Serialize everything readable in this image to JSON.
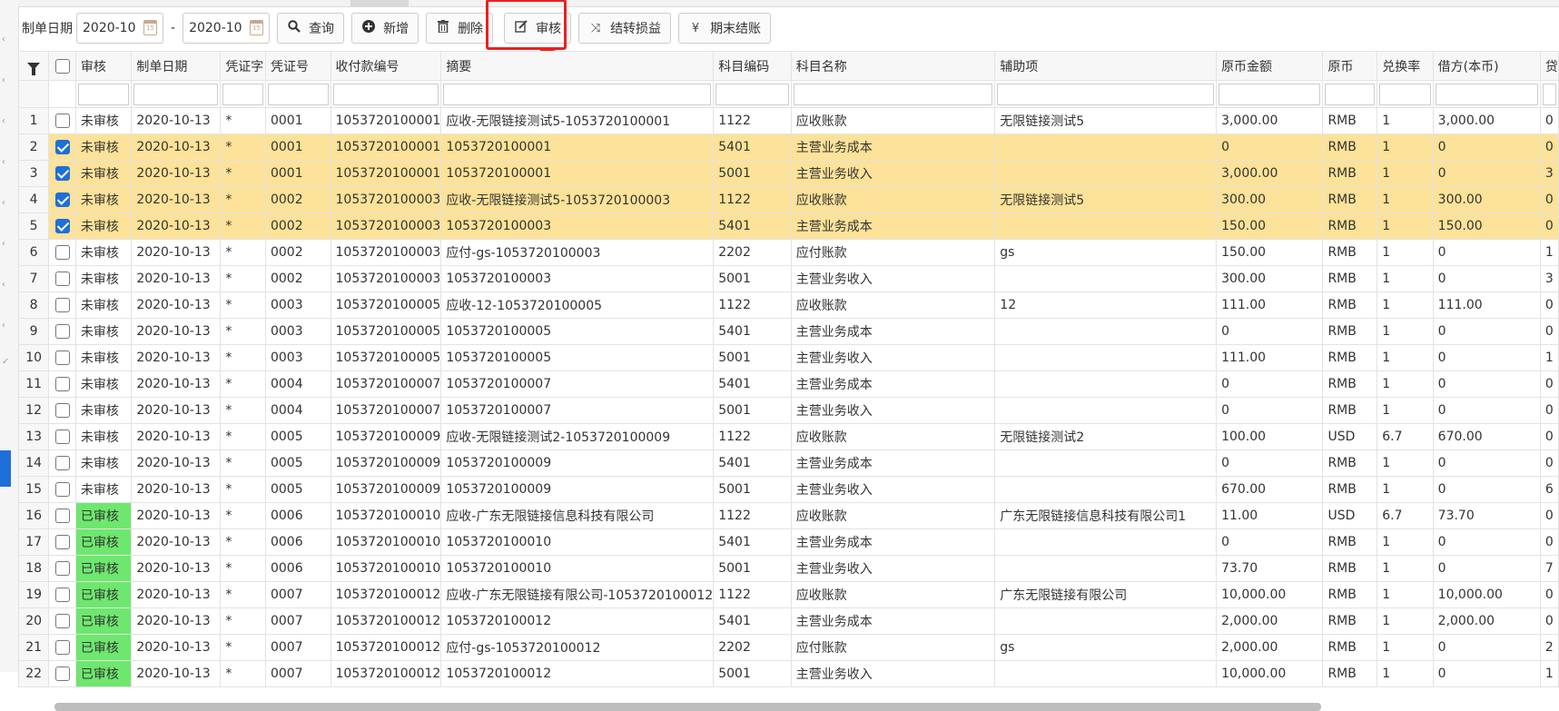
{
  "toolbar": {
    "date_label": "制单日期",
    "date_from": "2020-10",
    "date_to": "2020-10",
    "range_sep": "-",
    "buttons": {
      "query": "查询",
      "add": "新增",
      "delete": "删除",
      "audit": "审核",
      "carry_over": "结转损益",
      "period_end": "期末结账"
    },
    "icons": {
      "query": "search-icon",
      "add": "plus-circle-icon",
      "delete": "trash-icon",
      "audit": "edit-icon",
      "carry_over": "shuffle-icon",
      "period_end": "yen-icon"
    }
  },
  "colors": {
    "selected_row": "#fde299",
    "audited": "#6ee76e",
    "highlight": "#e8221f",
    "checkbox": "#1e6fd9"
  },
  "table": {
    "headers": [
      "审核",
      "制单日期",
      "凭证字",
      "凭证号",
      "收付款编号",
      "摘要",
      "科目编码",
      "科目名称",
      "辅助项",
      "原币金额",
      "原币",
      "兑换率",
      "借方(本币)",
      "贷"
    ],
    "rows": [
      {
        "num": "1",
        "checked": false,
        "status": "未审核",
        "audited": false,
        "date": "2020-10-13",
        "word": "*",
        "vno": "0001",
        "payno": "1053720100001",
        "summary": "应收-无限链接测试5-1053720100001",
        "code": "1122",
        "account": "应收账款",
        "aux": "无限链接测试5",
        "amount": "3,000.00",
        "cur": "RMB",
        "rate": "1",
        "debit": "3,000.00",
        "credit": "0"
      },
      {
        "num": "2",
        "checked": true,
        "status": "未审核",
        "audited": false,
        "date": "2020-10-13",
        "word": "*",
        "vno": "0001",
        "payno": "1053720100001",
        "summary": "1053720100001",
        "code": "5401",
        "account": "主营业务成本",
        "aux": "",
        "amount": "0",
        "cur": "RMB",
        "rate": "1",
        "debit": "0",
        "credit": "0"
      },
      {
        "num": "3",
        "checked": true,
        "status": "未审核",
        "audited": false,
        "date": "2020-10-13",
        "word": "*",
        "vno": "0001",
        "payno": "1053720100001",
        "summary": "1053720100001",
        "code": "5001",
        "account": "主营业务收入",
        "aux": "",
        "amount": "3,000.00",
        "cur": "RMB",
        "rate": "1",
        "debit": "0",
        "credit": "3"
      },
      {
        "num": "4",
        "checked": true,
        "status": "未审核",
        "audited": false,
        "date": "2020-10-13",
        "word": "*",
        "vno": "0002",
        "payno": "1053720100003",
        "summary": "应收-无限链接测试5-1053720100003",
        "code": "1122",
        "account": "应收账款",
        "aux": "无限链接测试5",
        "amount": "300.00",
        "cur": "RMB",
        "rate": "1",
        "debit": "300.00",
        "credit": "0"
      },
      {
        "num": "5",
        "checked": true,
        "status": "未审核",
        "audited": false,
        "date": "2020-10-13",
        "word": "*",
        "vno": "0002",
        "payno": "1053720100003",
        "summary": "1053720100003",
        "code": "5401",
        "account": "主营业务成本",
        "aux": "",
        "amount": "150.00",
        "cur": "RMB",
        "rate": "1",
        "debit": "150.00",
        "credit": "0"
      },
      {
        "num": "6",
        "checked": false,
        "status": "未审核",
        "audited": false,
        "date": "2020-10-13",
        "word": "*",
        "vno": "0002",
        "payno": "1053720100003",
        "summary": "应付-gs-1053720100003",
        "code": "2202",
        "account": "应付账款",
        "aux": "gs",
        "amount": "150.00",
        "cur": "RMB",
        "rate": "1",
        "debit": "0",
        "credit": "1"
      },
      {
        "num": "7",
        "checked": false,
        "status": "未审核",
        "audited": false,
        "date": "2020-10-13",
        "word": "*",
        "vno": "0002",
        "payno": "1053720100003",
        "summary": "1053720100003",
        "code": "5001",
        "account": "主营业务收入",
        "aux": "",
        "amount": "300.00",
        "cur": "RMB",
        "rate": "1",
        "debit": "0",
        "credit": "3"
      },
      {
        "num": "8",
        "checked": false,
        "status": "未审核",
        "audited": false,
        "date": "2020-10-13",
        "word": "*",
        "vno": "0003",
        "payno": "1053720100005",
        "summary": "应收-12-1053720100005",
        "code": "1122",
        "account": "应收账款",
        "aux": "12",
        "amount": "111.00",
        "cur": "RMB",
        "rate": "1",
        "debit": "111.00",
        "credit": "0"
      },
      {
        "num": "9",
        "checked": false,
        "status": "未审核",
        "audited": false,
        "date": "2020-10-13",
        "word": "*",
        "vno": "0003",
        "payno": "1053720100005",
        "summary": "1053720100005",
        "code": "5401",
        "account": "主营业务成本",
        "aux": "",
        "amount": "0",
        "cur": "RMB",
        "rate": "1",
        "debit": "0",
        "credit": "0"
      },
      {
        "num": "10",
        "checked": false,
        "status": "未审核",
        "audited": false,
        "date": "2020-10-13",
        "word": "*",
        "vno": "0003",
        "payno": "1053720100005",
        "summary": "1053720100005",
        "code": "5001",
        "account": "主营业务收入",
        "aux": "",
        "amount": "111.00",
        "cur": "RMB",
        "rate": "1",
        "debit": "0",
        "credit": "1"
      },
      {
        "num": "11",
        "checked": false,
        "status": "未审核",
        "audited": false,
        "date": "2020-10-13",
        "word": "*",
        "vno": "0004",
        "payno": "1053720100007",
        "summary": "1053720100007",
        "code": "5401",
        "account": "主营业务成本",
        "aux": "",
        "amount": "0",
        "cur": "RMB",
        "rate": "1",
        "debit": "0",
        "credit": "0"
      },
      {
        "num": "12",
        "checked": false,
        "status": "未审核",
        "audited": false,
        "date": "2020-10-13",
        "word": "*",
        "vno": "0004",
        "payno": "1053720100007",
        "summary": "1053720100007",
        "code": "5001",
        "account": "主营业务收入",
        "aux": "",
        "amount": "0",
        "cur": "RMB",
        "rate": "1",
        "debit": "0",
        "credit": "0"
      },
      {
        "num": "13",
        "checked": false,
        "status": "未审核",
        "audited": false,
        "date": "2020-10-13",
        "word": "*",
        "vno": "0005",
        "payno": "1053720100009",
        "summary": "应收-无限链接测试2-1053720100009",
        "code": "1122",
        "account": "应收账款",
        "aux": "无限链接测试2",
        "amount": "100.00",
        "cur": "USD",
        "rate": "6.7",
        "debit": "670.00",
        "credit": "0"
      },
      {
        "num": "14",
        "checked": false,
        "status": "未审核",
        "audited": false,
        "date": "2020-10-13",
        "word": "*",
        "vno": "0005",
        "payno": "1053720100009",
        "summary": "1053720100009",
        "code": "5401",
        "account": "主营业务成本",
        "aux": "",
        "amount": "0",
        "cur": "RMB",
        "rate": "1",
        "debit": "0",
        "credit": "0"
      },
      {
        "num": "15",
        "checked": false,
        "status": "未审核",
        "audited": false,
        "date": "2020-10-13",
        "word": "*",
        "vno": "0005",
        "payno": "1053720100009",
        "summary": "1053720100009",
        "code": "5001",
        "account": "主营业务收入",
        "aux": "",
        "amount": "670.00",
        "cur": "RMB",
        "rate": "1",
        "debit": "0",
        "credit": "6"
      },
      {
        "num": "16",
        "checked": false,
        "status": "已审核",
        "audited": true,
        "date": "2020-10-13",
        "word": "*",
        "vno": "0006",
        "payno": "1053720100010",
        "summary": "应收-广东无限链接信息科技有限公司",
        "code": "1122",
        "account": "应收账款",
        "aux": "广东无限链接信息科技有限公司1",
        "amount": "11.00",
        "cur": "USD",
        "rate": "6.7",
        "debit": "73.70",
        "credit": "0"
      },
      {
        "num": "17",
        "checked": false,
        "status": "已审核",
        "audited": true,
        "date": "2020-10-13",
        "word": "*",
        "vno": "0006",
        "payno": "1053720100010",
        "summary": "1053720100010",
        "code": "5401",
        "account": "主营业务成本",
        "aux": "",
        "amount": "0",
        "cur": "RMB",
        "rate": "1",
        "debit": "0",
        "credit": "0"
      },
      {
        "num": "18",
        "checked": false,
        "status": "已审核",
        "audited": true,
        "date": "2020-10-13",
        "word": "*",
        "vno": "0006",
        "payno": "1053720100010",
        "summary": "1053720100010",
        "code": "5001",
        "account": "主营业务收入",
        "aux": "",
        "amount": "73.70",
        "cur": "RMB",
        "rate": "1",
        "debit": "0",
        "credit": "7"
      },
      {
        "num": "19",
        "checked": false,
        "status": "已审核",
        "audited": true,
        "date": "2020-10-13",
        "word": "*",
        "vno": "0007",
        "payno": "1053720100012",
        "summary": "应收-广东无限链接有限公司-1053720100012",
        "code": "1122",
        "account": "应收账款",
        "aux": "广东无限链接有限公司",
        "amount": "10,000.00",
        "cur": "RMB",
        "rate": "1",
        "debit": "10,000.00",
        "credit": "0"
      },
      {
        "num": "20",
        "checked": false,
        "status": "已审核",
        "audited": true,
        "date": "2020-10-13",
        "word": "*",
        "vno": "0007",
        "payno": "1053720100012",
        "summary": "1053720100012",
        "code": "5401",
        "account": "主营业务成本",
        "aux": "",
        "amount": "2,000.00",
        "cur": "RMB",
        "rate": "1",
        "debit": "2,000.00",
        "credit": "0"
      },
      {
        "num": "21",
        "checked": false,
        "status": "已审核",
        "audited": true,
        "date": "2020-10-13",
        "word": "*",
        "vno": "0007",
        "payno": "1053720100012",
        "summary": "应付-gs-1053720100012",
        "code": "2202",
        "account": "应付账款",
        "aux": "gs",
        "amount": "2,000.00",
        "cur": "RMB",
        "rate": "1",
        "debit": "0",
        "credit": "2"
      },
      {
        "num": "22",
        "checked": false,
        "status": "已审核",
        "audited": true,
        "date": "2020-10-13",
        "word": "*",
        "vno": "0007",
        "payno": "1053720100012",
        "summary": "1053720100012",
        "code": "5001",
        "account": "主营业务收入",
        "aux": "",
        "amount": "10,000.00",
        "cur": "RMB",
        "rate": "1",
        "debit": "0",
        "credit": "1"
      }
    ]
  }
}
